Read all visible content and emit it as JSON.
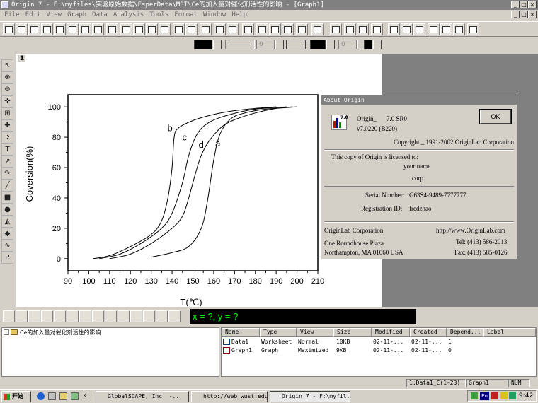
{
  "window": {
    "title": "Origin 7 - F:\\myfiles\\实验原始数据\\EsperData\\MST\\Ce的加入量对催化剂活性的影响 - [Graph1]",
    "min": "_",
    "max": "□",
    "close": "×"
  },
  "menu": [
    "File",
    "Edit",
    "View",
    "Graph",
    "Data",
    "Analysis",
    "Tools",
    "Format",
    "Window",
    "Help"
  ],
  "format_bar": {
    "width_value": "0",
    "size_value": "0"
  },
  "layer_number": "1",
  "chart_data": {
    "type": "line",
    "ylabel": "Coversion(%)",
    "xlabel": "T(℃)",
    "xlim": [
      90,
      210
    ],
    "ylim": [
      -8,
      108
    ],
    "x_ticks": [
      "90",
      "100",
      "110",
      "120",
      "130",
      "140",
      "150",
      "160",
      "170",
      "180",
      "190",
      "200",
      "210"
    ],
    "y_ticks": [
      "0",
      "20",
      "40",
      "60",
      "80",
      "100"
    ],
    "series": [
      {
        "name": "a",
        "label_at": [
          162,
          74
        ],
        "points": [
          [
            130,
            1
          ],
          [
            140,
            4
          ],
          [
            148,
            8
          ],
          [
            154,
            20
          ],
          [
            157,
            38
          ],
          [
            160,
            65
          ],
          [
            163,
            82
          ],
          [
            168,
            92
          ],
          [
            175,
            96
          ],
          [
            185,
            98.5
          ],
          [
            195,
            99.5
          ],
          [
            200,
            100
          ]
        ]
      },
      {
        "name": "b",
        "label_at": [
          139,
          84
        ],
        "points": [
          [
            102,
            0
          ],
          [
            110,
            2
          ],
          [
            120,
            8
          ],
          [
            130,
            16
          ],
          [
            135,
            25
          ],
          [
            138,
            40
          ],
          [
            140,
            60
          ],
          [
            141,
            80
          ],
          [
            143,
            86
          ],
          [
            150,
            91
          ],
          [
            160,
            95
          ],
          [
            170,
            97.5
          ],
          [
            180,
            99
          ],
          [
            190,
            100
          ]
        ]
      },
      {
        "name": "c",
        "label_at": [
          146,
          78
        ],
        "points": [
          [
            105,
            0
          ],
          [
            115,
            3
          ],
          [
            125,
            10
          ],
          [
            135,
            20
          ],
          [
            140,
            30
          ],
          [
            145,
            50
          ],
          [
            148,
            68
          ],
          [
            152,
            82
          ],
          [
            158,
            90
          ],
          [
            168,
            95
          ],
          [
            180,
            98.5
          ],
          [
            195,
            100
          ]
        ]
      },
      {
        "name": "d",
        "label_at": [
          154,
          73
        ],
        "points": [
          [
            110,
            0
          ],
          [
            120,
            3
          ],
          [
            130,
            10
          ],
          [
            140,
            20
          ],
          [
            145,
            28
          ],
          [
            148,
            40
          ],
          [
            151,
            55
          ],
          [
            154,
            68
          ],
          [
            158,
            78
          ],
          [
            165,
            88
          ],
          [
            175,
            94
          ],
          [
            188,
            98.5
          ],
          [
            198,
            100
          ]
        ]
      }
    ]
  },
  "about": {
    "title": "About Origin",
    "product": "Origin_",
    "version": "7.0 SR0",
    "build": "v7.0220 (B220)",
    "copyright": "Copyright _ 1991-2002 OriginLab Corporation",
    "licensed": "This copy of Origin is licensed to:",
    "user": "your name",
    "company": "corp",
    "serial_label": "Serial Number:",
    "serial": "G63S4-9489-7777777",
    "reg_label": "Registration ID:",
    "reg": "fredzhao",
    "corp": "OriginLab Corporation",
    "url": "http://www.OriginLab.com",
    "addr1": "One Roundhouse Plaza",
    "addr2": "Northampton, MA 01060 USA",
    "tel": "Tel: (413) 586-2013",
    "fax": "Fax: (413) 585-0126",
    "ok": "OK",
    "icon_text": "7.0"
  },
  "coord_readout": "x = ?, y = ?",
  "project": {
    "folder": "Ce的加入量对催化剂活性的影响",
    "columns": [
      "Name",
      "Type",
      "View",
      "Size",
      "Modified",
      "Created",
      "Depend...",
      "Label"
    ],
    "rows": [
      [
        "Data1",
        "Worksheet",
        "Normal",
        "10KB",
        "02-11-...",
        "02-11-...",
        "1",
        ""
      ],
      [
        "Graph1",
        "Graph",
        "Maximized",
        "9KB",
        "02-11-...",
        "02-11-...",
        "0",
        ""
      ]
    ]
  },
  "status": {
    "cell": "1:Data1_C(1-23)",
    "window": "Graph1",
    "num": "NUM"
  },
  "taskbar": {
    "start": "开始",
    "tasks": [
      "GlobalSCAPE, Inc. -...",
      "http://web.wust.edu...",
      "Origin 7 - F:\\myfil..."
    ],
    "chevron": "»",
    "time": "9:42",
    "lang": "En"
  }
}
